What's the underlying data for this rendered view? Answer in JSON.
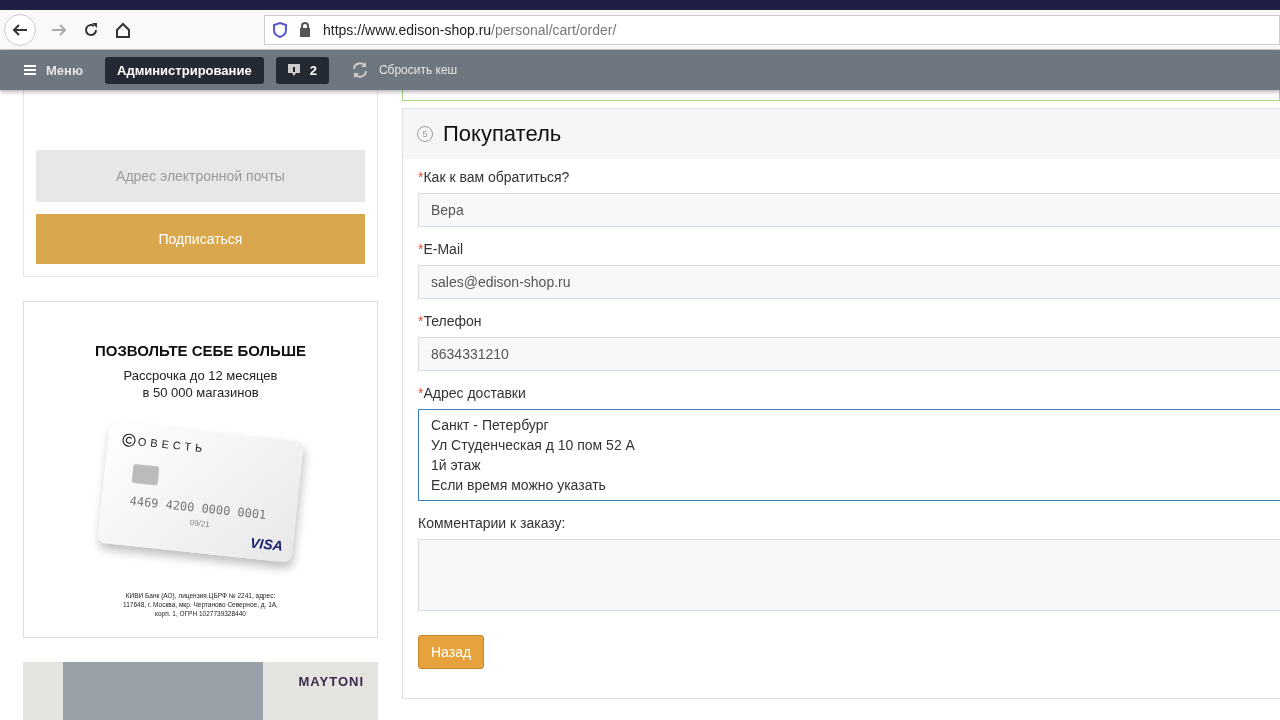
{
  "browser": {
    "url_host": "https://www.edison-shop.ru",
    "url_path": "/personal/cart/order/"
  },
  "admin_bar": {
    "menu": "Меню",
    "admin": "Администрирование",
    "notifications": "2",
    "cache": "Сбросить кеш"
  },
  "subscribe": {
    "email_placeholder": "Адрес электронной почты",
    "button": "Подписаться"
  },
  "ad": {
    "title": "ПОЗВОЛЬТЕ СЕБЕ БОЛЬШЕ",
    "subtitle": "Рассрочка до 12 месяцев\nв 50 000 магазинов",
    "card_brand": "ОВЕСТЬ",
    "card_number": "4469 4200 0000 0001",
    "card_expiry": "09/21",
    "card_network": "VISA",
    "fine_print": "КИВИ Банк (АО), лицензия ЦБРФ № 2241, адрес:\n117648, г. Москва, мкр. Чертаново Северное, д. 1А,\nкорп. 1, ОГРН 1027739328440"
  },
  "banner2": {
    "brand": "MAYTONI"
  },
  "buyer": {
    "step": "5",
    "title": "Покупатель",
    "fields": [
      {
        "label": "Как к вам обратиться?",
        "required_mark": "*",
        "value": "Вера",
        "focused": false,
        "kind": "input"
      },
      {
        "label": "E-Mail",
        "required_mark": "*",
        "value": "sales@edison-shop.ru",
        "focused": false,
        "kind": "input"
      },
      {
        "label": "Телефон",
        "required_mark": "*",
        "value": "8634331210",
        "focused": false,
        "kind": "input"
      },
      {
        "label": "Адрес доставки",
        "required_mark": "*",
        "value": "Санкт - Петербург\nУл Студенческая д 10 пом 52 А\n1й этаж\nЕсли время можно указать",
        "focused": true,
        "kind": "textarea"
      },
      {
        "label": "Комментарии к заказу:",
        "focused": false,
        "kind": "textarea"
      }
    ],
    "back": "Назад"
  }
}
